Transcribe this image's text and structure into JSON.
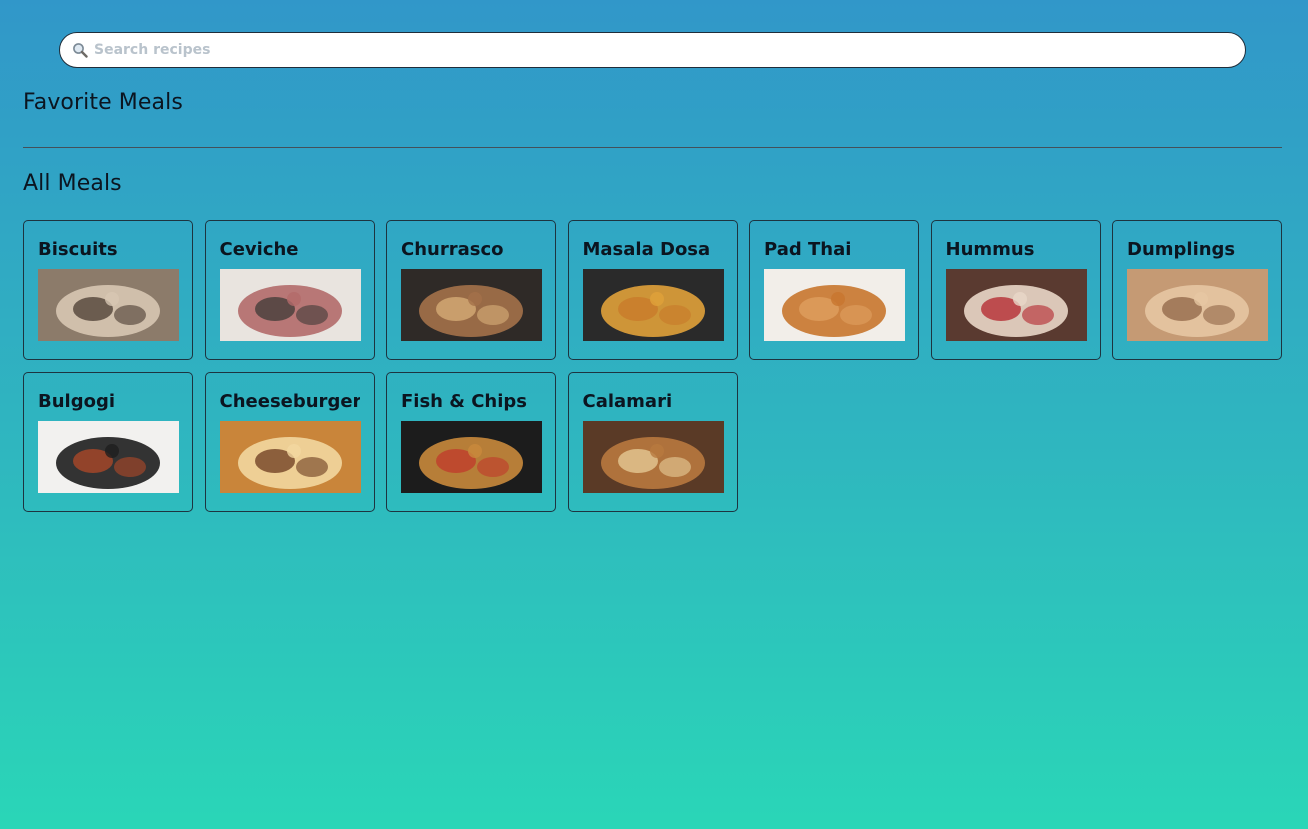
{
  "search": {
    "placeholder": "Search recipes",
    "icon": "magnifying-glass-icon"
  },
  "sections": {
    "favorites_title": "Favorite Meals",
    "all_title": "All Meals"
  },
  "meals": [
    {
      "name": "Biscuits",
      "image": "biscuits-photo",
      "palette": [
        "#8c7b6a",
        "#d7c7b3",
        "#4a3b30"
      ]
    },
    {
      "name": "Ceviche",
      "image": "ceviche-photo",
      "palette": [
        "#e9e4df",
        "#b36a6a",
        "#3d3a37"
      ]
    },
    {
      "name": "Churrasco",
      "image": "churrasco-photo",
      "palette": [
        "#2f2a27",
        "#a4714a",
        "#d9b07a"
      ]
    },
    {
      "name": "Masala Dosa",
      "image": "masala-dosa-photo",
      "palette": [
        "#2a2a2a",
        "#e0a13a",
        "#c87a2a"
      ]
    },
    {
      "name": "Pad Thai",
      "image": "pad-thai-photo",
      "palette": [
        "#f2eee9",
        "#c8752e",
        "#e0a060"
      ]
    },
    {
      "name": "Hummus",
      "image": "hummus-photo",
      "palette": [
        "#5a3a30",
        "#e9d7c8",
        "#b3232b"
      ]
    },
    {
      "name": "Dumplings",
      "image": "dumplings-photo",
      "palette": [
        "#c59a74",
        "#e6c7a3",
        "#8f6446"
      ]
    },
    {
      "name": "Bulgogi",
      "image": "bulgogi-photo",
      "palette": [
        "#f2f1ef",
        "#1e1e1e",
        "#b34a28"
      ]
    },
    {
      "name": "Cheeseburger",
      "image": "cheeseburger-photo",
      "palette": [
        "#c9853a",
        "#f2d7a0",
        "#6b3a1f"
      ]
    },
    {
      "name": "Fish & Chips",
      "image": "fish-and-chips-photo",
      "palette": [
        "#1c1c1c",
        "#c98a3c",
        "#c0392b"
      ]
    },
    {
      "name": "Calamari",
      "image": "calamari-photo",
      "palette": [
        "#5a3a26",
        "#b8793f",
        "#e8cf9a"
      ]
    }
  ]
}
